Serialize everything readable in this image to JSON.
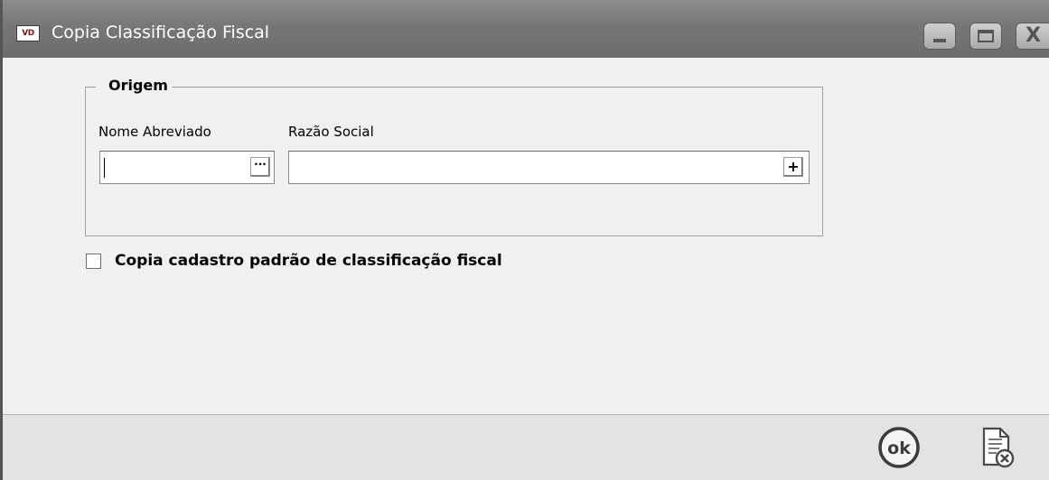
{
  "window": {
    "app_icon_text": "VD",
    "title": "Copia Classificação Fiscal",
    "controls": {
      "minimize_icon": "minimize-icon",
      "maximize_icon": "maximize-icon",
      "close_icon": "close-icon",
      "close_glyph": "X"
    }
  },
  "origem": {
    "legend": "Origem",
    "nome_abreviado": {
      "label": "Nome Abreviado",
      "value": "",
      "lookup_button_label": "···"
    },
    "razao_social": {
      "label": "Razão Social",
      "value": "",
      "add_button_label": "+"
    }
  },
  "options": {
    "copia_padrao_label": "Copia cadastro padrão de classificação fiscal",
    "copia_padrao_checked": false
  },
  "footer": {
    "ok_label": "ok",
    "ok_icon": "ok-circle-icon",
    "cancel_icon": "document-cancel-icon"
  },
  "colors": {
    "titlebar": "#777777",
    "window_bg": "#f0f0f0",
    "footer_bg": "#e3e3e3"
  }
}
